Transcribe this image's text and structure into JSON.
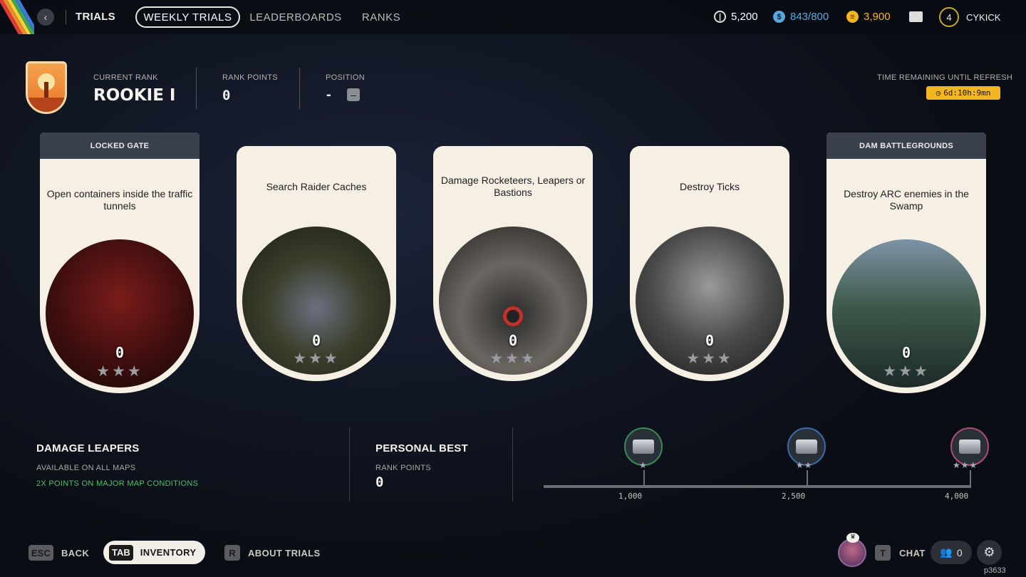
{
  "topbar": {
    "title": "TRIALS",
    "tabs": [
      {
        "label": "WEEKLY TRIALS",
        "active": true
      },
      {
        "label": "LEADERBOARDS"
      },
      {
        "label": "RANKS"
      }
    ],
    "currencies": [
      {
        "value": "5,200",
        "color": "#ffffff",
        "icon": "coin-icon"
      },
      {
        "value": "843/800",
        "color": "#5aa7e0",
        "icon": "token-icon"
      },
      {
        "value": "3,900",
        "color": "#f2b623",
        "icon": "credits-icon"
      }
    ],
    "level": "4",
    "username": "CYKICK"
  },
  "rank": {
    "current_rank_label": "CURRENT RANK",
    "current_rank": "ROOKIE I",
    "rank_points_label": "RANK POINTS",
    "rank_points": "0",
    "position_label": "POSITION",
    "position": "-",
    "refresh_label": "TIME REMAINING UNTIL REFRESH",
    "refresh_time": "6d:10h:9mn"
  },
  "cards": [
    {
      "header": "LOCKED GATE",
      "title": "Open containers inside the traffic tunnels",
      "score": "0",
      "stars": "★★★"
    },
    {
      "header": "",
      "title": "Search Raider Caches",
      "score": "0",
      "stars": "★★★"
    },
    {
      "header": "",
      "title": "Damage Rocketeers, Leapers or Bastions",
      "score": "0",
      "stars": "★★★"
    },
    {
      "header": "",
      "title": "Destroy Ticks",
      "score": "0",
      "stars": "★★★"
    },
    {
      "header": "DAM BATTLEGROUNDS",
      "title": "Destroy ARC enemies in the Swamp",
      "score": "0",
      "stars": "★★★"
    }
  ],
  "selected": {
    "title": "DAMAGE LEAPERS",
    "maps": "AVAILABLE ON ALL MAPS",
    "bonus": "2X POINTS ON MAJOR MAP CONDITIONS"
  },
  "personal_best": {
    "title": "PERSONAL BEST",
    "label": "RANK POINTS",
    "value": "0"
  },
  "rewards": {
    "thresholds": [
      "1,000",
      "2,500",
      "4,000"
    ],
    "stars": [
      "★",
      "★★",
      "★★★"
    ],
    "accents": [
      "#3a8a5a",
      "#3d6aa8",
      "#b04a7a"
    ],
    "progress": 0
  },
  "footer": {
    "back_key": "ESC",
    "back": "BACK",
    "inv_key": "TAB",
    "inventory": "INVENTORY",
    "about_key": "R",
    "about": "ABOUT TRIALS",
    "chat_key": "T",
    "chat": "CHAT",
    "friends": "0",
    "build": "p3633"
  }
}
